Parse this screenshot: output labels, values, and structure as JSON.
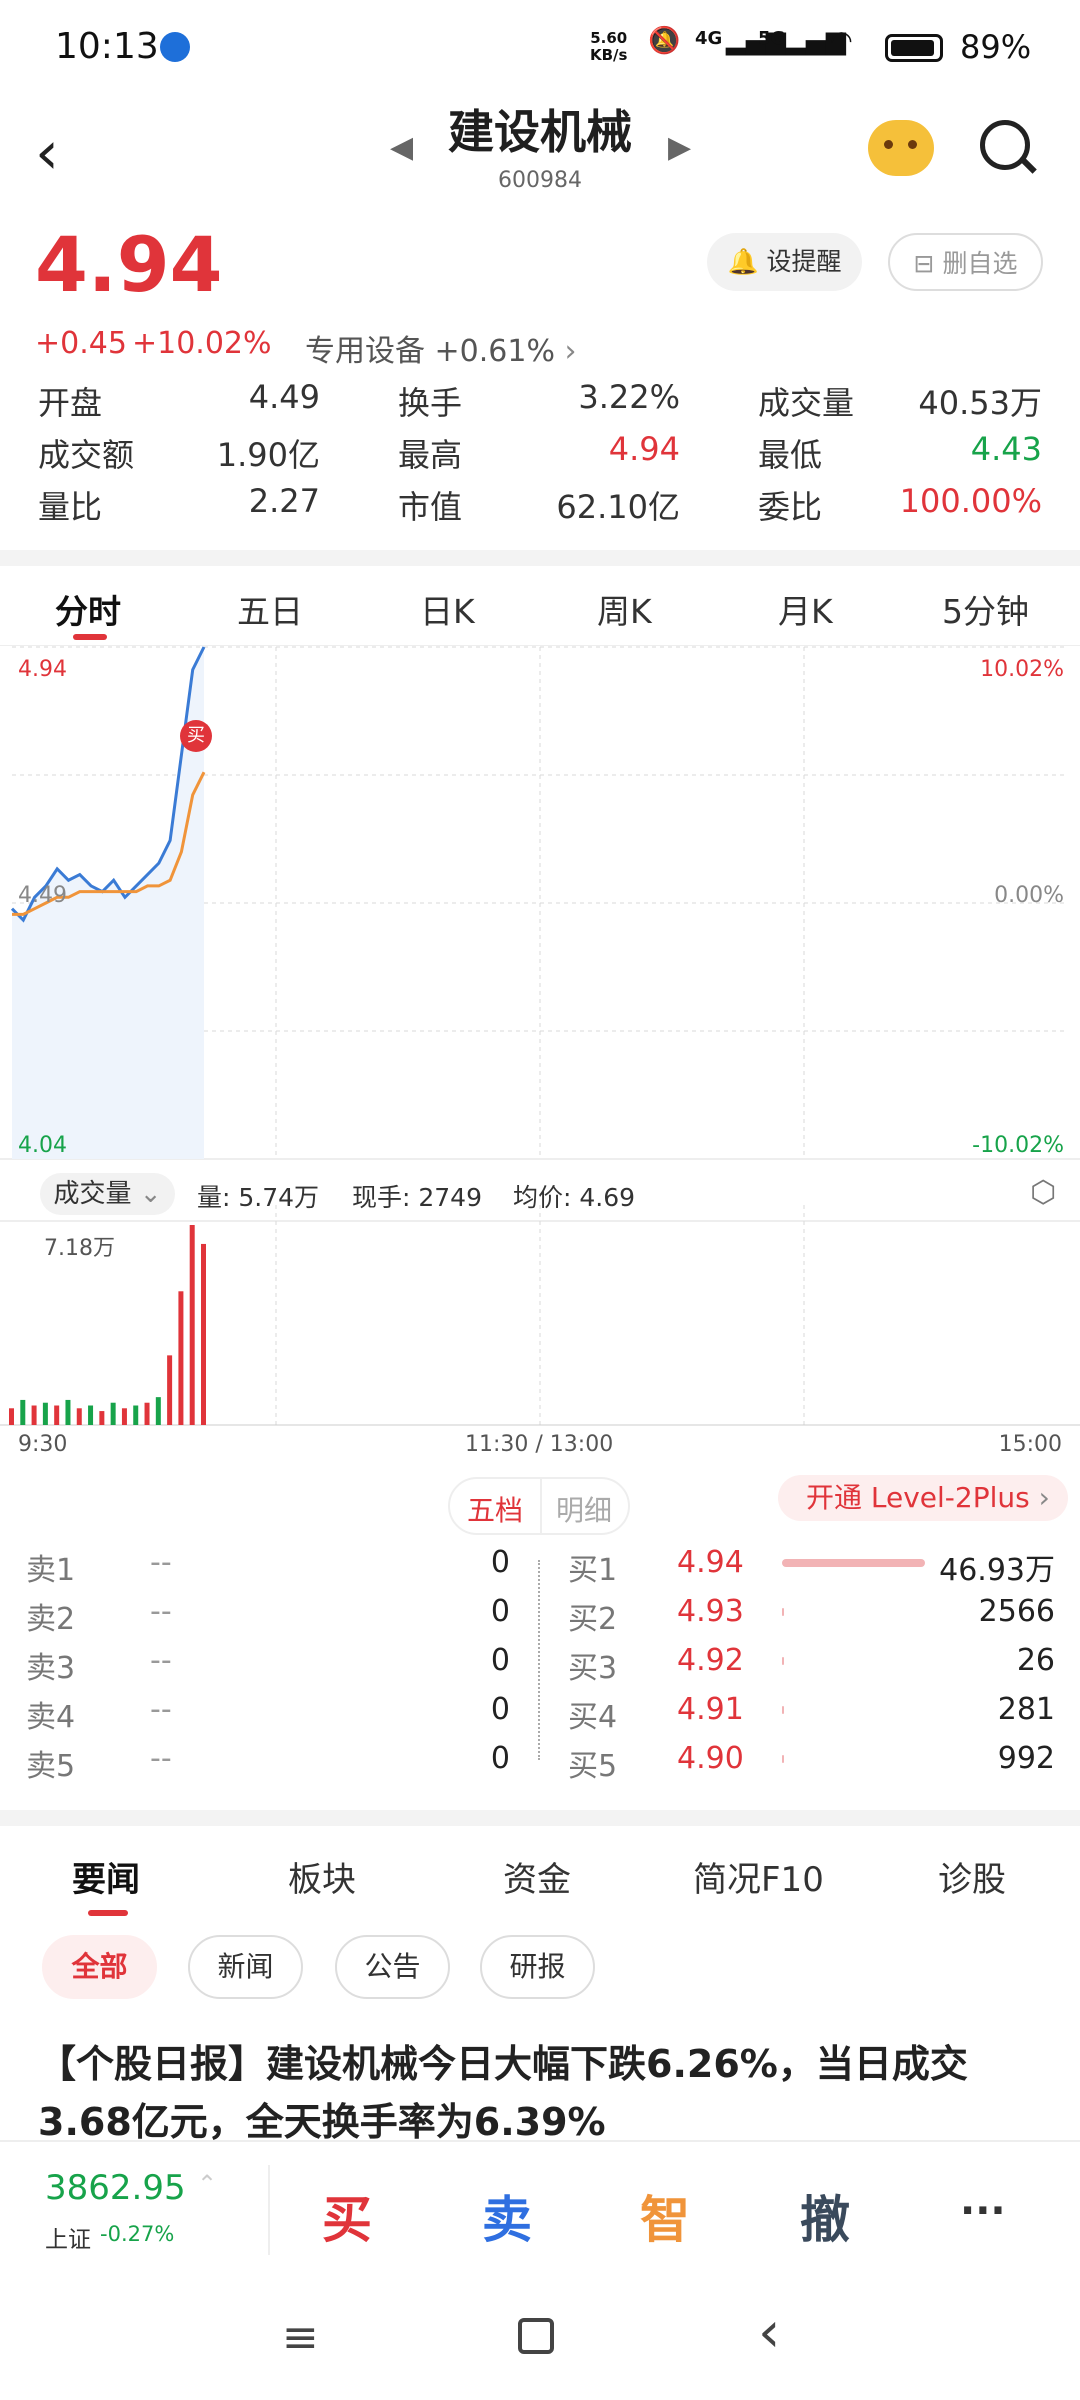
{
  "status": {
    "time": "10:13",
    "net_speed": "5.60",
    "net_unit": "KB/s",
    "net4g": "4G",
    "net5g": "5G",
    "battery": "89%"
  },
  "header": {
    "title": "建设机械",
    "code": "600984",
    "back_icon": "chevron-left-icon",
    "search_icon": "search-icon"
  },
  "quote": {
    "price": "4.94",
    "change": "+0.45",
    "change_pct": "+10.02%",
    "sector": "专用设备 +0.61%",
    "alert_label": "设提醒",
    "watch_label": "删自选",
    "stats": [
      [
        {
          "label": "开盘",
          "value": "4.49",
          "color": "#333"
        },
        {
          "label": "换手",
          "value": "3.22%",
          "color": "#333"
        },
        {
          "label": "成交量",
          "value": "40.53万",
          "color": "#333"
        }
      ],
      [
        {
          "label": "成交额",
          "value": "1.90亿",
          "color": "#333"
        },
        {
          "label": "最高",
          "value": "4.94",
          "color": "#e0343a"
        },
        {
          "label": "最低",
          "value": "4.43",
          "color": "#17a34a"
        }
      ],
      [
        {
          "label": "量比",
          "value": "2.27",
          "color": "#333"
        },
        {
          "label": "市值",
          "value": "62.10亿",
          "color": "#333"
        },
        {
          "label": "委比",
          "value": "100.00%",
          "color": "#e0343a"
        }
      ]
    ]
  },
  "chart_tabs": [
    "分时",
    "五日",
    "日K",
    "周K",
    "月K",
    "5分钟"
  ],
  "chart": {
    "price_high": "4.94",
    "price_low": "4.04",
    "price_mid": "4.49",
    "pct_high": "10.02%",
    "pct_mid": "0.00%",
    "pct_low": "-10.02%",
    "buy_marker": "买",
    "volume_label": "成交量",
    "volume_info": "量: 5.74万",
    "now_hand": "现手: 2749",
    "avg_price": "均价: 4.69",
    "volume_max": "7.18万",
    "time_start": "9:30",
    "time_mid": "11:30 / 13:00",
    "time_end": "15:00"
  },
  "chart_data": {
    "type": "line",
    "x": [
      "9:30",
      "9:33",
      "9:36",
      "9:39",
      "9:42",
      "9:45",
      "9:48",
      "9:51",
      "9:54",
      "9:57",
      "10:00",
      "10:03",
      "10:06",
      "10:09",
      "10:10",
      "10:11",
      "10:12",
      "10:13"
    ],
    "series": [
      {
        "values": [
          4.48,
          4.46,
          4.5,
          4.52,
          4.55,
          4.53,
          4.54,
          4.52,
          4.51,
          4.53,
          4.5,
          4.52,
          4.54,
          4.56,
          4.6,
          4.75,
          4.9,
          4.94
        ]
      },
      {
        "values": [
          4.47,
          4.47,
          4.48,
          4.49,
          4.5,
          4.5,
          4.51,
          4.51,
          4.51,
          4.51,
          4.51,
          4.51,
          4.52,
          4.52,
          4.53,
          4.58,
          4.68,
          4.72
        ]
      }
    ],
    "volume": [
      0.6,
      0.9,
      0.7,
      0.8,
      0.7,
      0.9,
      0.6,
      0.7,
      0.5,
      0.8,
      0.6,
      0.7,
      0.8,
      1.0,
      2.5,
      4.8,
      7.18,
      6.5
    ],
    "ylim": [
      4.04,
      4.94
    ],
    "line_colors": [
      "#3a7bd5",
      "#f0943a"
    ]
  },
  "orderbook": {
    "tab_active": "五档",
    "tab_other": "明细",
    "level2": "开通 Level-2Plus",
    "sell": [
      {
        "label": "卖1",
        "price": "--",
        "vol": "0"
      },
      {
        "label": "卖2",
        "price": "--",
        "vol": "0"
      },
      {
        "label": "卖3",
        "price": "--",
        "vol": "0"
      },
      {
        "label": "卖4",
        "price": "--",
        "vol": "0"
      },
      {
        "label": "卖5",
        "price": "--",
        "vol": "0"
      }
    ],
    "buy": [
      {
        "label": "买1",
        "price": "4.94",
        "vol": "46.93万",
        "bar": 0.95
      },
      {
        "label": "买2",
        "price": "4.93",
        "vol": "2566",
        "bar": 0.01
      },
      {
        "label": "买3",
        "price": "4.92",
        "vol": "26",
        "bar": 0.005
      },
      {
        "label": "买4",
        "price": "4.91",
        "vol": "281",
        "bar": 0.005
      },
      {
        "label": "买5",
        "price": "4.90",
        "vol": "992",
        "bar": 0.005
      }
    ]
  },
  "news": {
    "tabs": [
      "要闻",
      "板块",
      "资金",
      "简况F10",
      "诊股"
    ],
    "chips": [
      "全部",
      "新闻",
      "公告",
      "研报"
    ],
    "headline": "【个股日报】建设机械今日大幅下跌6.26%，当日成交3.68亿元，全天换手率为6.39%"
  },
  "bottom": {
    "index_value": "3862.95",
    "index_name": "上证",
    "index_change": "-0.27%",
    "buy": "买",
    "sell": "卖",
    "smart": "智",
    "cancel": "撤",
    "more": "···"
  }
}
